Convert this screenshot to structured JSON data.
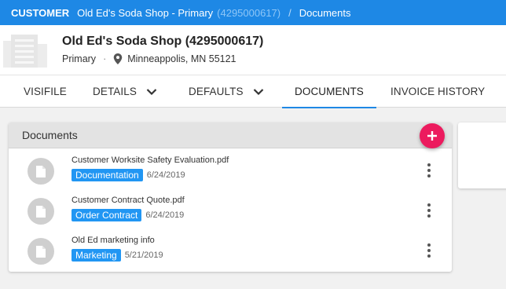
{
  "breadcrumb": {
    "root": "CUSTOMER",
    "name": "Old Ed's Soda Shop - Primary",
    "id": "(4295000617)",
    "separator": "/",
    "current": "Documents"
  },
  "header": {
    "title": "Old Ed's Soda Shop (4295000617)",
    "type": "Primary",
    "separator": "·",
    "location": "Minneappolis, MN 55121"
  },
  "tabs": [
    {
      "label": "VISIFILE",
      "has_dropdown": false
    },
    {
      "label": "DETAILS",
      "has_dropdown": true
    },
    {
      "label": "DEFAULTS",
      "has_dropdown": true
    },
    {
      "label": "DOCUMENTS",
      "active": true
    },
    {
      "label": "INVOICE HISTORY"
    }
  ],
  "documents_panel": {
    "title": "Documents",
    "add_icon": "plus-icon",
    "items": [
      {
        "name": "Customer Worksite Safety Evaluation.pdf",
        "tag": "Documentation",
        "date": "6/24/2019"
      },
      {
        "name": "Customer Contract Quote.pdf",
        "tag": "Order Contract",
        "date": "6/24/2019"
      },
      {
        "name": "Old Ed marketing info",
        "tag": "Marketing",
        "date": "5/21/2019"
      }
    ]
  },
  "colors": {
    "breadcrumb_bg": "#1e88e5",
    "fab": "#ec1b5e",
    "tag": "#2196f3",
    "active_tab_underline": "#1e88e5"
  }
}
